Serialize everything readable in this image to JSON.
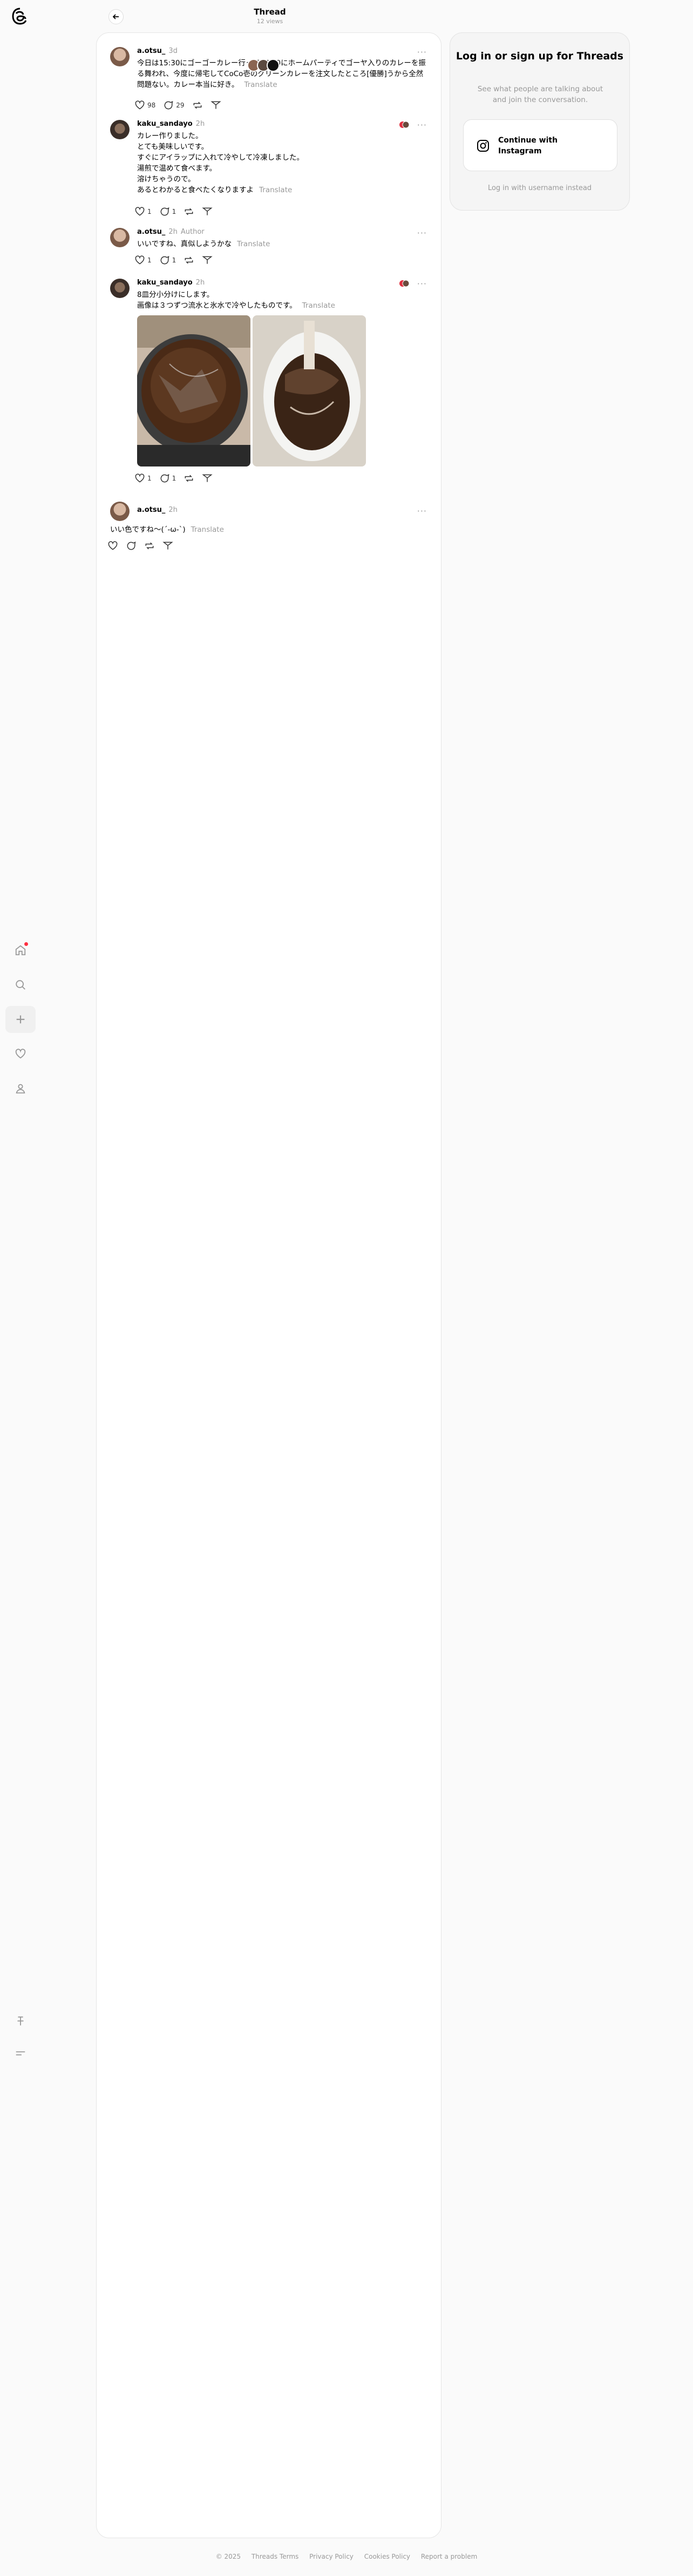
{
  "header": {
    "title": "Thread",
    "views": "12 views"
  },
  "nav": {
    "items": [
      {
        "name": "home",
        "icon": "home-icon"
      },
      {
        "name": "search",
        "icon": "search-icon"
      },
      {
        "name": "create",
        "icon": "plus-icon"
      },
      {
        "name": "activity",
        "icon": "heart-icon"
      },
      {
        "name": "profile",
        "icon": "profile-icon"
      },
      {
        "name": "pin",
        "icon": "pin-icon"
      },
      {
        "name": "menu",
        "icon": "menu-icon"
      }
    ]
  },
  "posts": [
    {
      "user": "a.otsu_",
      "time": "3d",
      "author_tag": "",
      "lines": [
        "今日は15:30にゴーゴーカレー行って17:30にホームパーティでゴーヤ入りのカレーを振る舞われ、今度に帰宅してCoCo壱のグリーンカレーを注文したところ[優勝]うから全然問題ない。カレー本当に好き。"
      ],
      "translate": "Translate",
      "likes": "98",
      "replies": "29",
      "reposts": "",
      "shares": ""
    },
    {
      "user": "kaku_sandayo",
      "time": "2h",
      "author_tag": "",
      "lines": [
        "カレー作りました。",
        "とても美味しいです。",
        "すぐにアイラップに入れて冷やして冷凍しました。",
        "湯煎で温めて食べます。",
        "溶けちゃうので。",
        "あるとわかると食べたくなりますよ"
      ],
      "translate": "Translate",
      "likes": "1",
      "replies": "1",
      "reposts": "",
      "shares": ""
    },
    {
      "user": "a.otsu_",
      "time": "2h",
      "author_tag": "Author",
      "lines": [
        "いいですね、真似しようかな"
      ],
      "translate": "Translate",
      "likes": "1",
      "replies": "1",
      "reposts": "",
      "shares": ""
    },
    {
      "user": "kaku_sandayo",
      "time": "2h",
      "author_tag": "",
      "lines": [
        "8皿分小分けにします。",
        "画像は３つずつ流水と氷水で冷やしたものです。"
      ],
      "translate": "Translate",
      "likes": "1",
      "replies": "1",
      "reposts": "",
      "shares": ""
    },
    {
      "user": "a.otsu_",
      "time": "2h",
      "author_tag": "",
      "lines": [
        "いい色ですね〜(⁠´⁠-⁠ω⁠-⁠`⁠)"
      ],
      "translate": "Translate",
      "likes": "",
      "replies": "",
      "reposts": "",
      "shares": ""
    }
  ],
  "more_label": "···",
  "login": {
    "title": "Log in or sign up for Threads",
    "subtitle": "See what people are talking about and join the conversation.",
    "instagram_button": "Continue with Instagram",
    "alt_link": "Log in with username instead"
  },
  "footer": {
    "copyright": "© 2025",
    "links": [
      "Threads Terms",
      "Privacy Policy",
      "Cookies Policy",
      "Report a problem"
    ]
  },
  "colors": {
    "accent": "#000000",
    "muted": "#999999",
    "notification": "#ff3040"
  }
}
